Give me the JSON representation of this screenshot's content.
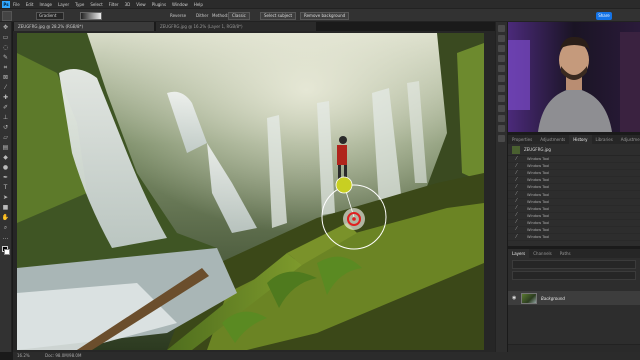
{
  "app": {
    "logo": "Ps"
  },
  "menu": [
    "File",
    "Edit",
    "Image",
    "Layer",
    "Type",
    "Select",
    "Filter",
    "3D",
    "View",
    "Plugins",
    "Window",
    "Help"
  ],
  "options": {
    "preset": "Gradient",
    "reverse": "Reverse",
    "dither": "Dither",
    "method_label": "Method:",
    "method_value": "Classic",
    "select_subject": "Select subject",
    "remove_background": "Remove background",
    "share": "Share"
  },
  "document": {
    "tab": "ZEUGFRG.jpg @ 28.2% (RGB/8*)",
    "tab2": "ZEUGFRG.jpg @ 16.2% (Layer 1, RGB/8*)"
  },
  "history": {
    "tabs": [
      "Properties",
      "Adjustments",
      "History",
      "Libraries",
      "Adjustments"
    ],
    "active_tab": "History",
    "snapshot": "ZEUGFRG.jpg",
    "steps": [
      "Window Tool",
      "Window Tool",
      "Window Tool",
      "Window Tool",
      "Window Tool",
      "Window Tool",
      "Window Tool",
      "Window Tool",
      "Window Tool",
      "Window Tool",
      "Window Tool",
      "Window Tool"
    ]
  },
  "layers": {
    "tabs": [
      "Layers",
      "Channels",
      "Paths"
    ],
    "active_tab": "Layers",
    "layer_name": "Background"
  },
  "status": {
    "zoom": "16.2%",
    "doc": "Doc: 98.0M/98.0M"
  },
  "colors": {
    "accent": "#31a8ff",
    "share": "#1473e6"
  }
}
